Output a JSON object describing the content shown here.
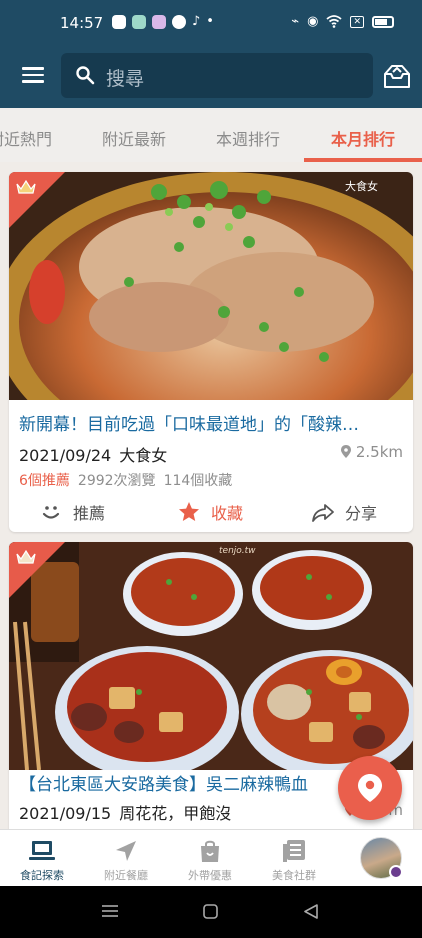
{
  "status_bar": {
    "time": "14:57"
  },
  "search": {
    "placeholder": "搜尋"
  },
  "tabs": [
    {
      "label": "附近熱門",
      "active": false
    },
    {
      "label": "附近最新",
      "active": false
    },
    {
      "label": "本週排行",
      "active": false
    },
    {
      "label": "本月排行",
      "active": true
    }
  ],
  "posts": [
    {
      "title": "新開幕！目前吃過「口味最道地」的「酸辣…",
      "date": "2021/09/24",
      "author": "大食女",
      "distance": "2.5km",
      "recommend_count": "6個推薦",
      "views": "2992次瀏覽",
      "saves": "114個收藏",
      "watermark": "大食女"
    },
    {
      "title": "【台北東區大安路美食】吳二麻辣鴨血",
      "date": "2021/09/15",
      "author": "周花花，甲飽沒",
      "distance": "798m",
      "watermark": "tenjo.tw"
    }
  ],
  "actions": {
    "recommend": "推薦",
    "save": "收藏",
    "share": "分享"
  },
  "bottom_nav": [
    {
      "label": "食記探索",
      "icon": "laptop-icon",
      "active": true
    },
    {
      "label": "附近餐廳",
      "icon": "navigation-arrow-icon",
      "active": false
    },
    {
      "label": "外帶優惠",
      "icon": "shopping-bag-icon",
      "active": false
    },
    {
      "label": "美食社群",
      "icon": "article-icon",
      "active": false
    }
  ],
  "colors": {
    "primary": "#1f4b64",
    "accent": "#e9604a",
    "link": "#1a6aa0"
  }
}
